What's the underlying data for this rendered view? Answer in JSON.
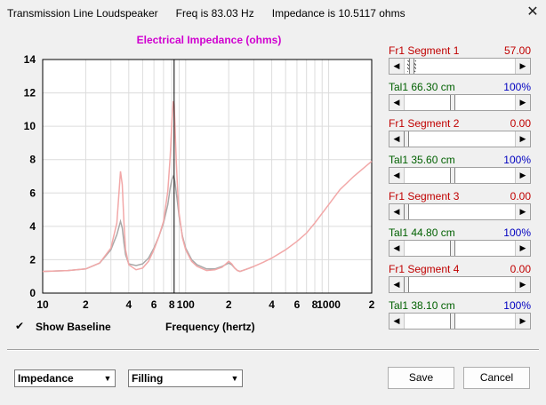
{
  "window": {
    "app_title": "Transmission Line Loudspeaker",
    "freq_text": "Freq is 83.03 Hz",
    "impedance_text": "Impedance is 10.5117 ohms",
    "close_glyph": "✕"
  },
  "plot": {
    "title": "Electrical Impedance (ohms)",
    "x_axis_title": "Frequency (hertz)",
    "show_baseline_label": "Show Baseline",
    "show_baseline_checked": true
  },
  "segments": [
    {
      "name": "Fr1  Segment 1",
      "value": "57.00",
      "fraction": 0.05,
      "hatched": true
    },
    {
      "name": "Tal1  66.30 cm",
      "value": "100%",
      "fraction": 0.43
    },
    {
      "name": "Fr1  Segment 2",
      "value": "0.00",
      "fraction": 0.0
    },
    {
      "name": "Tal1  35.60 cm",
      "value": "100%",
      "fraction": 0.43
    },
    {
      "name": "Fr1  Segment 3",
      "value": "0.00",
      "fraction": 0.0
    },
    {
      "name": "Tal1  44.80 cm",
      "value": "100%",
      "fraction": 0.43
    },
    {
      "name": "Fr1  Segment 4",
      "value": "0.00",
      "fraction": 0.0
    },
    {
      "name": "Tal1  38.10 cm",
      "value": "100%",
      "fraction": 0.43
    }
  ],
  "controls": {
    "plot_select": "Impedance",
    "filling_select": "Filling",
    "save_label": "Save",
    "cancel_label": "Cancel"
  },
  "colors": {
    "title_magenta": "#d000d0",
    "curve_pink": "#f2a8a8",
    "baseline_gray": "#a8a8a8",
    "segment_red": "#c00000",
    "segment_green": "#006000",
    "segment_blue": "#0000c0"
  },
  "chart_data": {
    "type": "line",
    "title": "Electrical Impedance (ohms)",
    "xlabel": "Frequency (hertz)",
    "ylabel": "",
    "x_scale": "log",
    "xlim": [
      10,
      2000
    ],
    "ylim": [
      0,
      14
    ],
    "x_tick_labels": [
      {
        "f": 10,
        "label": "10"
      },
      {
        "f": 20,
        "label": "2"
      },
      {
        "f": 40,
        "label": "4"
      },
      {
        "f": 60,
        "label": "6"
      },
      {
        "f": 80,
        "label": "8"
      },
      {
        "f": 100,
        "label": "100"
      },
      {
        "f": 200,
        "label": "2"
      },
      {
        "f": 400,
        "label": "4"
      },
      {
        "f": 600,
        "label": "6"
      },
      {
        "f": 800,
        "label": "8"
      },
      {
        "f": 1000,
        "label": "1000"
      },
      {
        "f": 2000,
        "label": "2"
      }
    ],
    "y_ticks": [
      0,
      2,
      4,
      6,
      8,
      10,
      12,
      14
    ],
    "grid": true,
    "cursor_freq": 83.03,
    "series": [
      {
        "color": "#f2a8a8",
        "x": [
          10,
          15,
          20,
          25,
          30,
          33,
          35,
          36,
          37,
          38,
          40,
          45,
          50,
          55,
          60,
          65,
          70,
          75,
          78,
          80,
          82,
          83,
          84,
          86,
          88,
          90,
          95,
          100,
          110,
          120,
          140,
          160,
          180,
          200,
          210,
          220,
          230,
          240,
          260,
          280,
          300,
          350,
          400,
          500,
          600,
          700,
          800,
          1000,
          1200,
          1500,
          2000
        ],
        "y": [
          1.3,
          1.35,
          1.45,
          1.8,
          2.7,
          4.2,
          7.3,
          6.5,
          4.2,
          2.6,
          1.7,
          1.4,
          1.5,
          1.9,
          2.6,
          3.4,
          4.3,
          6.1,
          8.2,
          10.2,
          11.5,
          11.3,
          10.3,
          7.8,
          6.0,
          4.8,
          3.3,
          2.6,
          1.9,
          1.6,
          1.35,
          1.4,
          1.55,
          1.9,
          1.75,
          1.5,
          1.35,
          1.3,
          1.4,
          1.5,
          1.6,
          1.85,
          2.1,
          2.6,
          3.1,
          3.6,
          4.2,
          5.3,
          6.2,
          7.0,
          7.9
        ]
      },
      {
        "color": "#a8a8a8",
        "x": [
          10,
          15,
          20,
          25,
          30,
          33,
          35,
          36,
          37,
          38,
          40,
          45,
          50,
          55,
          60,
          65,
          70,
          75,
          78,
          80,
          82,
          83,
          84,
          86,
          88,
          90,
          95,
          100,
          110,
          120,
          140,
          160,
          180,
          200,
          210,
          220,
          230,
          240,
          260,
          280,
          300
        ],
        "y": [
          1.3,
          1.35,
          1.45,
          1.8,
          2.6,
          3.5,
          4.3,
          3.9,
          3.0,
          2.3,
          1.75,
          1.65,
          1.75,
          2.1,
          2.7,
          3.4,
          4.2,
          5.3,
          6.3,
          6.8,
          7.0,
          6.9,
          6.7,
          6.0,
          5.3,
          4.6,
          3.4,
          2.7,
          2.0,
          1.7,
          1.45,
          1.45,
          1.6,
          1.8,
          1.7,
          1.5,
          1.35,
          1.3,
          1.4,
          1.5,
          1.6
        ]
      }
    ]
  }
}
